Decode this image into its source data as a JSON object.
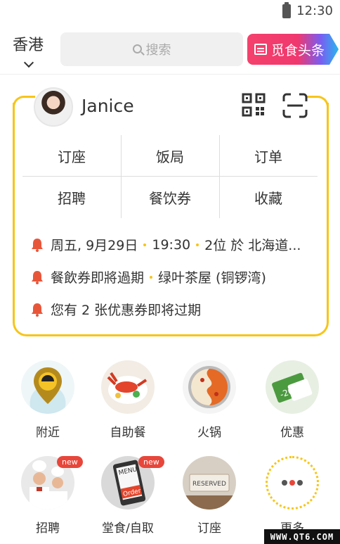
{
  "status_bar": {
    "time": "12:30"
  },
  "header": {
    "city": "香港",
    "search_placeholder": "搜索",
    "headline_button": "觅食头条"
  },
  "profile": {
    "name": "Janice"
  },
  "quick_grid": {
    "items": [
      "订座",
      "饭局",
      "订单",
      "招聘",
      "餐饮券",
      "收藏"
    ]
  },
  "notices": [
    {
      "parts": [
        "周五, 9月29日",
        "19:30",
        "2位 於 北海道..."
      ]
    },
    {
      "parts": [
        "餐飲券即將過期",
        "绿叶茶屋 (铜锣湾)"
      ]
    },
    {
      "parts": [
        "您有 2 张优惠券即将过期"
      ]
    }
  ],
  "categories": [
    {
      "label": "附近",
      "icon": "location-pin-icon"
    },
    {
      "label": "自助餐",
      "icon": "buffet-lobster-icon"
    },
    {
      "label": "火锅",
      "icon": "hotpot-icon"
    },
    {
      "label": "优惠",
      "icon": "discount-coupon-icon",
      "coupon_text": "-20%"
    },
    {
      "label": "招聘",
      "icon": "chefs-icon",
      "badge": "new"
    },
    {
      "label": "堂食/自取",
      "icon": "menu-order-icon",
      "badge": "new",
      "menu_text": "MENU",
      "order_text": "Order"
    },
    {
      "label": "订座",
      "icon": "reserved-sign-icon",
      "sign_text": "RESERVED"
    },
    {
      "label": "更多",
      "icon": "more-dots-icon"
    }
  ],
  "watermark": "WWW.QT6.COM",
  "colors": {
    "accent": "#f7c518",
    "alert": "#e8463a"
  }
}
